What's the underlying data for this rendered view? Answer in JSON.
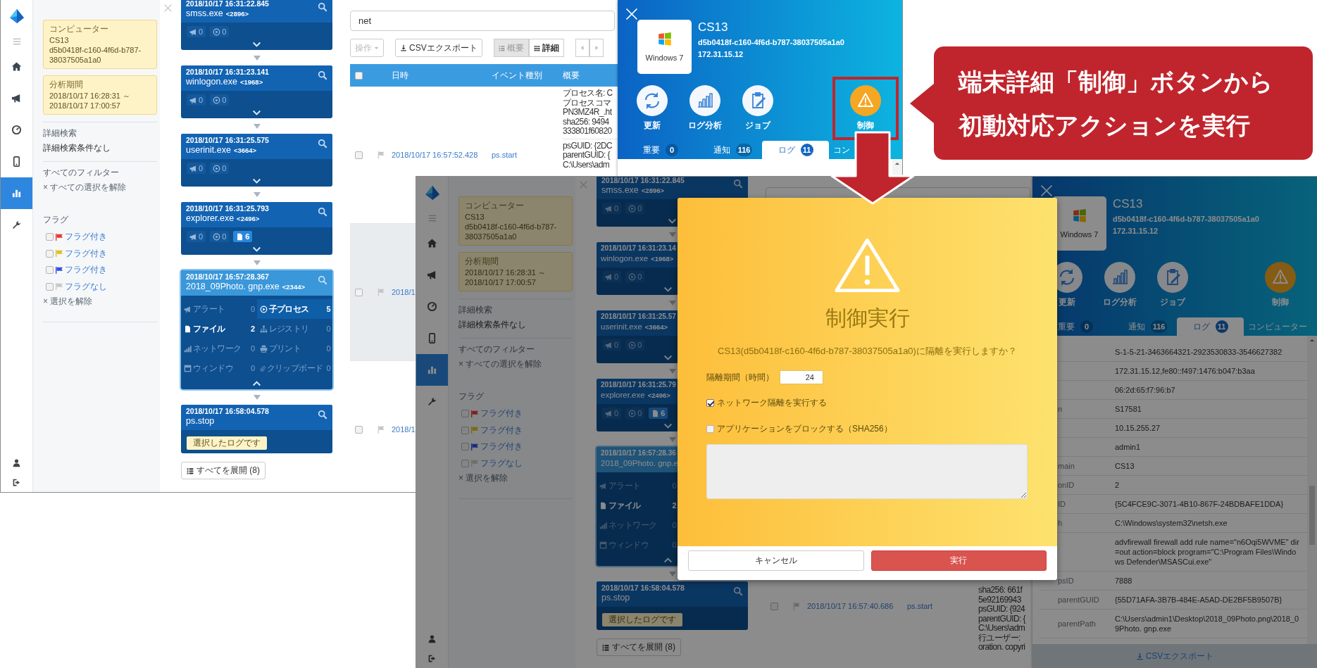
{
  "first_screenshot": {
    "nav": [
      {
        "kind": "home",
        "selected": false
      },
      {
        "kind": "megaphone",
        "selected": false
      },
      {
        "kind": "gauge",
        "selected": false
      },
      {
        "kind": "phone",
        "selected": false
      },
      {
        "kind": "chart",
        "selected": true
      },
      {
        "kind": "wrench",
        "selected": false
      }
    ],
    "filters": {
      "computer": {
        "label": "コンピューター",
        "name": "CS13",
        "id": "d5b0418f-c160-4f6d-b787-38037505a1a0"
      },
      "period": {
        "label": "分析期間",
        "value": "2018/10/17 16:28:31 ～ 2018/10/17 17:00:57"
      },
      "advanced_search": {
        "label": "詳細検索",
        "value": "詳細検索条件なし"
      },
      "all_filters": {
        "label": "すべてのフィルター",
        "clear": "× すべての選択を解除"
      },
      "flags": {
        "label": "フラグ",
        "items": [
          {
            "label": "フラグ付き",
            "color": "#e53935",
            "checked": false
          },
          {
            "label": "フラグ付き",
            "color": "#e0c020",
            "checked": false
          },
          {
            "label": "フラグ付き",
            "color": "#3050e0",
            "checked": false
          },
          {
            "label": "フラグなし",
            "color": "#c8c8c8",
            "checked": false
          }
        ],
        "clear": "× 選択を解除"
      }
    },
    "cards": [
      {
        "time": "2018/10/17 16:31:22.845",
        "process": "smss.exe",
        "pid": "<2896>",
        "selected": false,
        "expanded": false,
        "badges": [
          {
            "kind": "alert",
            "count": "0",
            "active": false
          },
          {
            "kind": "child_process",
            "count": "0",
            "active": false
          }
        ]
      },
      {
        "time": "2018/10/17 16:31:23.141",
        "process": "winlogon.exe",
        "pid": "<1968>",
        "selected": false,
        "expanded": false,
        "badges": [
          {
            "kind": "alert",
            "count": "0",
            "active": false
          },
          {
            "kind": "child_process",
            "count": "0",
            "active": false
          }
        ]
      },
      {
        "time": "2018/10/17 16:31:25.575",
        "process": "userinit.exe",
        "pid": "<3664>",
        "selected": false,
        "expanded": false,
        "badges": [
          {
            "kind": "alert",
            "count": "0",
            "active": false
          },
          {
            "kind": "child_process",
            "count": "0",
            "active": false
          }
        ]
      },
      {
        "time": "2018/10/17 16:31:25.793",
        "process": "explorer.exe",
        "pid": "<2496>",
        "selected": false,
        "expanded": false,
        "badges": [
          {
            "kind": "alert",
            "count": "0",
            "active": false
          },
          {
            "kind": "child_process",
            "count": "0",
            "active": false
          },
          {
            "kind": "file",
            "count": "6",
            "active": true
          }
        ]
      },
      {
        "time": "2018/10/17 16:57:28.367",
        "process": "2018_09Photo. gnp.exe",
        "pid": "<2344>",
        "selected": true,
        "expanded": true,
        "stats": [
          {
            "kind": "alert",
            "label": "アラート",
            "count": "0",
            "active": false,
            "selected": false
          },
          {
            "kind": "child_process",
            "label": "子プロセス",
            "count": "5",
            "active": true,
            "selected": true
          },
          {
            "kind": "file",
            "label": "ファイル",
            "count": "2",
            "active": true,
            "selected": false
          },
          {
            "kind": "registry",
            "label": "レジストリ",
            "count": "0",
            "active": false,
            "selected": false
          },
          {
            "kind": "network",
            "label": "ネットワーク",
            "count": "0",
            "active": false,
            "selected": false
          },
          {
            "kind": "print",
            "label": "プリント",
            "count": "0",
            "active": false,
            "selected": false
          },
          {
            "kind": "window",
            "label": "ウィンドウ",
            "count": "0",
            "active": false,
            "selected": false
          },
          {
            "kind": "clipboard",
            "label": "クリップボード",
            "count": "0",
            "active": false,
            "selected": false
          }
        ]
      },
      {
        "time": "2018/10/17 16:58:04.578",
        "process": "ps.stop",
        "selected": false,
        "note": "選択したログです"
      }
    ],
    "expand_all": "すべてを展開 (8)",
    "table": {
      "search": "net",
      "toolbar": {
        "action_menu": {
          "label": "操作",
          "disabled": true
        },
        "export": "CSVエクスポート",
        "views": [
          {
            "kind": "list",
            "label": "概要",
            "selected": true
          },
          {
            "kind": "grid",
            "label": "詳細",
            "selected": false
          }
        ]
      },
      "columns": [
        "日時",
        "イベント種別",
        "概要"
      ],
      "select_all_checked": false,
      "rows": [
        {
          "date": "2018/10/17 16:57:52.428",
          "event": "ps.start",
          "selected": false,
          "checked": false,
          "summary": [
            [
              "プロセス名: C",
              "プロセスコマ",
              "PN3MZ4R_.ht",
              "sha256: 9494",
              "333801f60820"
            ],
            [
              "psGUID: {2DC",
              "parentGUID: {",
              "C:\\Users\\adm"
            ]
          ]
        },
        {
          "date": "2018/1",
          "selected": true,
          "checked": false
        },
        {
          "date": "2018/1",
          "selected": false,
          "checked": false
        }
      ]
    },
    "device_panel": {
      "os": "Windows 7",
      "name": "CS13",
      "guid": "d5b0418f-c160-4f6d-b787-38037505a1a0",
      "ip": "172.31.15.12",
      "actions": [
        {
          "kind": "refresh",
          "label": "更新",
          "highlighted": false
        },
        {
          "kind": "analysis",
          "label": "ログ分析",
          "highlighted": false
        },
        {
          "kind": "job",
          "label": "ジョブ",
          "highlighted": false
        },
        {
          "kind": "control",
          "label": "制御",
          "highlighted": true
        }
      ],
      "tabs": [
        {
          "label": "重要",
          "count": "0",
          "selected": false
        },
        {
          "label": "通知",
          "count": "116",
          "selected": false
        },
        {
          "label": "ログ",
          "count": "11",
          "selected": true
        },
        {
          "label": "コン",
          "selected": false
        }
      ]
    }
  },
  "second_screenshot": {
    "nav": [
      {
        "kind": "home",
        "selected": false
      },
      {
        "kind": "megaphone",
        "selected": false
      },
      {
        "kind": "gauge",
        "selected": false
      },
      {
        "kind": "phone",
        "selected": false
      },
      {
        "kind": "chart",
        "selected": true
      },
      {
        "kind": "wrench",
        "selected": false
      }
    ],
    "filters": {
      "computer": {
        "label": "コンピューター",
        "name": "CS13",
        "id": "d5b0418f-c160-4f6d-b787-38037505a1a0"
      },
      "period": {
        "label": "分析期間",
        "value": "2018/10/17 16:28:31 ～ 2018/10/17 17:00:57"
      },
      "advanced_search": {
        "label": "詳細検索",
        "value": "詳細検索条件なし"
      },
      "all_filters": {
        "label": "すべてのフィルター",
        "clear": "× すべての選択を解除"
      },
      "flags": {
        "label": "フラグ",
        "items": [
          {
            "label": "フラグ付き",
            "color": "#7e1f1d",
            "checked": false
          },
          {
            "label": "フラグ付き",
            "color": "#7b6a12",
            "checked": false
          },
          {
            "label": "フラグ付き",
            "color": "#1a2c7b",
            "checked": false
          },
          {
            "label": "フラグなし",
            "color": "#6e6e6e",
            "checked": false
          }
        ],
        "clear": "× 選択を解除"
      }
    },
    "cards": [
      {
        "time": "2018/10/17 16:31:22.845",
        "process": "smss.exe",
        "pid": "<2896>",
        "selected": false,
        "expanded": false,
        "badges": [
          {
            "kind": "alert",
            "count": "0",
            "active": false
          },
          {
            "kind": "child_process",
            "count": "0",
            "active": false
          }
        ]
      },
      {
        "time": "2018/10/17 16:31:23.14",
        "process": "winlogon.exe",
        "pid": "<1968>",
        "selected": false,
        "expanded": false,
        "badges": [
          {
            "kind": "alert",
            "count": "0",
            "active": false
          },
          {
            "kind": "child_process",
            "count": "0",
            "active": false
          }
        ]
      },
      {
        "time": "2018/10/17 16:31:25.57",
        "process": "userinit.exe",
        "pid": "<3664>",
        "selected": false,
        "expanded": false,
        "badges": [
          {
            "kind": "alert",
            "count": "0",
            "active": false
          },
          {
            "kind": "child_process",
            "count": "0",
            "active": false
          }
        ]
      },
      {
        "time": "2018/10/17 16:31:25.79",
        "process": "explorer.exe",
        "pid": "<2496>",
        "selected": false,
        "expanded": false,
        "badges": [
          {
            "kind": "alert",
            "count": "0",
            "active": false
          },
          {
            "kind": "child_process",
            "count": "0",
            "active": false
          },
          {
            "kind": "file",
            "count": "6",
            "active": true
          }
        ]
      },
      {
        "time": "2018/10/17 16:57:28.36",
        "process": "2018_09Photo. gnp.e",
        "selected": true,
        "expanded": true,
        "stats": [
          {
            "kind": "alert",
            "label": "アラート",
            "count": "0",
            "active": false,
            "selected": false
          },
          {
            "kind": "file",
            "label": "ファイル",
            "count": "2",
            "active": true,
            "selected": false
          },
          {
            "kind": "network",
            "label": "ネットワーク",
            "count": "0",
            "active": false,
            "selected": false
          },
          {
            "kind": "window",
            "label": "ウィンドウ",
            "count": "0",
            "active": false,
            "selected": false
          }
        ]
      },
      {
        "time": "2018/10/17 16:58:04.578",
        "process": "ps.stop",
        "selected": false,
        "note": "選択したログです"
      }
    ],
    "expand_all": "すべてを展開 (8)",
    "table": {
      "rows": [
        {
          "date": "2018/10/17 16:57:40.686",
          "event": "ps.start",
          "selected": false,
          "checked": false,
          "summary": [
            [
              "sha256: 661f",
              "5e92169943",
              "psGUID: {924",
              "parentGUID: {",
              "C:\\Users\\adm",
              "行ユーザー:",
              "oration. copyri"
            ]
          ]
        }
      ]
    },
    "device_panel": {
      "os": "Windows 7",
      "name": "CS13",
      "guid": "d5b0418f-c160-4f6d-b787-38037505a1a0",
      "ip": "172.31.15.12",
      "actions": [
        {
          "kind": "refresh",
          "label": "更新",
          "highlighted": false
        },
        {
          "kind": "analysis",
          "label": "ログ分析",
          "highlighted": false
        },
        {
          "kind": "job",
          "label": "ジョブ",
          "highlighted": false
        },
        {
          "kind": "control",
          "label": "制御",
          "highlighted": false
        }
      ],
      "tabs": [
        {
          "label": "重要",
          "count": "0",
          "selected": false
        },
        {
          "label": "通知",
          "count": "116",
          "selected": false
        },
        {
          "label": "ログ",
          "count": "11",
          "selected": true
        },
        {
          "label": "コンピューター",
          "selected": false
        }
      ],
      "rows": [
        {
          "value": "S-1-5-21-3463664321-2923530833-3546627382"
        },
        {
          "value": "172.31.15.12,fe80::f497:1476:b047:b3aa"
        },
        {
          "value": "06:2d:65:f7:96:b7"
        },
        {
          "key": "n",
          "value": "S17581"
        },
        {
          "value": "10.15.255.27"
        },
        {
          "value": "admin1"
        },
        {
          "key": "main",
          "value": "CS13"
        },
        {
          "key": "onID",
          "value": "2"
        },
        {
          "key": "ID",
          "value": "{5C4FCE9C-3071-4B10-867F-24BDBAFE1DDA}"
        },
        {
          "key": "h",
          "value": "C:\\Windows\\system32\\netsh.exe"
        },
        {
          "value": "advfirewall firewall add rule name=\"n6Oqi5WVME\" dir=out action=block program=\"C:\\Program Files\\Windows Defender\\MSASCui.exe\""
        },
        {
          "key": "psID",
          "value": "7888"
        },
        {
          "key": "parentGUID",
          "value": "{55D71AFA-3B7B-484E-A5AD-DE2BF5B9507B}"
        },
        {
          "key": "parentPath",
          "value": "C:\\Users\\admin1\\Desktop\\2018_09Photo.png\\2018_09Photo. gnp.exe"
        }
      ],
      "export": "CSVエクスポート"
    }
  },
  "control_dialog": {
    "title": "制御実行",
    "message": "CS13(d5b0418f-c160-4f6d-b787-38037505a1a0)に隔離を実行しますか？",
    "duration": {
      "label": "隔離期間（時間）",
      "value": "24"
    },
    "options": [
      {
        "label": "ネットワーク隔離を実行する",
        "checked": true
      },
      {
        "label": "アプリケーションをブロックする（SHA256）",
        "checked": false
      }
    ],
    "buttons": [
      {
        "kind": "cancel",
        "label": "キャンセル"
      },
      {
        "kind": "primary",
        "label": "実行"
      }
    ]
  },
  "callout": {
    "lines": [
      "端末詳細「制御」ボタンから",
      "初動対応アクションを実行"
    ]
  }
}
